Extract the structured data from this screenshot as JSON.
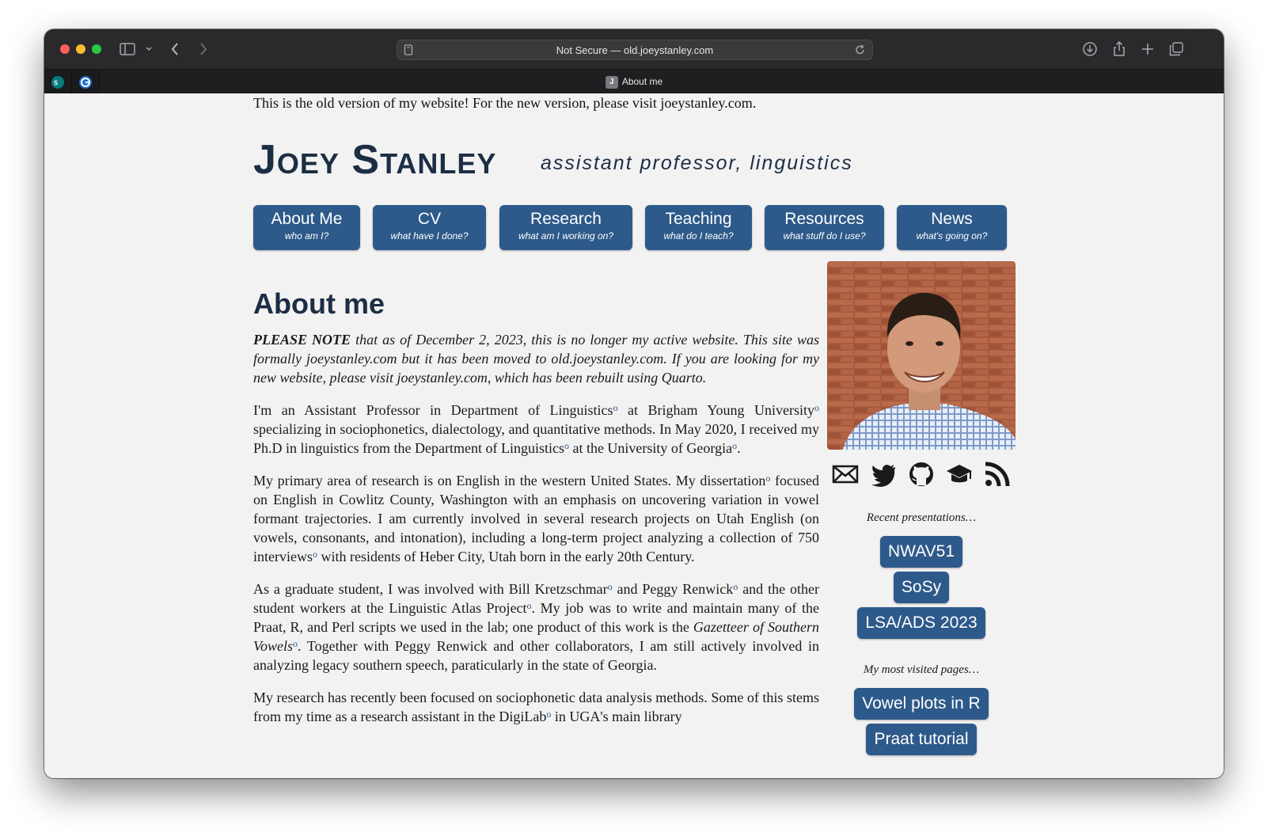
{
  "browser": {
    "address": "Not Secure — old.joeystanley.com",
    "tab_title": "About me",
    "tab_favicon_letter": "J"
  },
  "site": {
    "notice": "This is the old version of my website! For the new version, please visit joeystanley.com.",
    "name": "Joey Stanley",
    "tagline": "assistant professor, linguistics"
  },
  "nav": [
    {
      "label": "About Me",
      "sub": "who am I?"
    },
    {
      "label": "CV",
      "sub": "what have I done?"
    },
    {
      "label": "Research",
      "sub": "what am I working on?"
    },
    {
      "label": "Teaching",
      "sub": "what do I teach?"
    },
    {
      "label": "Resources",
      "sub": "what stuff do I use?"
    },
    {
      "label": "News",
      "sub": "what's going on?"
    }
  ],
  "main": {
    "title": "About me",
    "note_bold": "PLEASE NOTE",
    "note_rest": " that as of December 2, 2023, this is no longer my active website. This site was formally joeystanley.com but it has been moved to old.joeystanley.com. If you are looking for my new website, please visit joeystanley.com, which has been rebuilt using Quarto.",
    "p1": {
      "a": "I'm an Assistant Professor in Department of Linguistics",
      "b": " at Brigham Young University",
      "c": " specializing in sociophonetics, dialectology, and quantitative methods. In May 2020, I received my Ph.D in linguistics from the Department of Linguistics",
      "d": " at the University of Georgia",
      "e": "."
    },
    "p2": {
      "a": "My primary area of research is on English in the western United States. My dissertation",
      "b": " focused on English in Cowlitz County, Washington with an emphasis on uncovering variation in vowel formant trajectories. I am currently involved in several research projects on Utah English (on vowels, consonants, and intonation), including a long-term project analyzing a collection of 750 interviews",
      "c": " with residents of Heber City, Utah born in the early 20th Century."
    },
    "p3": {
      "a": "As a graduate student, I was involved with Bill Kretzschmar",
      "b": " and Peggy Renwick",
      "c": " and the other student workers at the Linguistic Atlas Project",
      "d": ". My job was to write and maintain many of the Praat, R, and Perl scripts we used in the lab; one product of this work is the ",
      "e": "Gazetteer of Southern Vowels",
      "f": ". Together with Peggy Renwick and other collaborators, I am still actively involved in analyzing legacy southern speech, paraticularly in the state of Georgia."
    },
    "p4": {
      "a": "My research has recently been focused on sociophonetic data analysis methods. Some of this stems from my time as a research assistant in the DigiLab",
      "b": " in UGA's main library"
    },
    "link_marker": "o"
  },
  "side": {
    "social_icons": [
      "email-icon",
      "twitter-icon",
      "github-icon",
      "scholar-icon",
      "rss-icon"
    ],
    "recent_heading": "Recent presentations…",
    "presentations": [
      "NWAV51",
      "SoSy",
      "LSA/ADS 2023"
    ],
    "visited_heading": "My most visited pages…",
    "pages": [
      "Vowel plots in R",
      "Praat tutorial"
    ]
  },
  "colors": {
    "accent": "#2d5a8a",
    "heading": "#1c2e44",
    "background": "#f2f2f2"
  }
}
